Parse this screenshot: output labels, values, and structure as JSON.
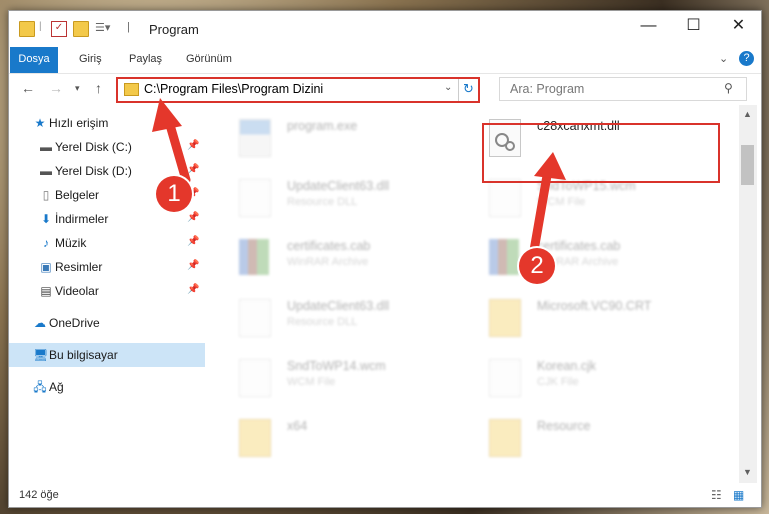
{
  "window": {
    "title": "Program"
  },
  "ribbon": {
    "tabs": [
      "Dosya",
      "Giriş",
      "Paylaş",
      "Görünüm"
    ]
  },
  "address": {
    "path": "C:\\Program Files\\Program Dizini"
  },
  "search": {
    "placeholder": "Ara: Program"
  },
  "sidebar": {
    "items": [
      {
        "label": "Hızlı erişim",
        "icon": "star-icon"
      },
      {
        "label": "Yerel Disk (C:)",
        "icon": "drive-icon"
      },
      {
        "label": "Yerel Disk (D:)",
        "icon": "drive-icon"
      },
      {
        "label": "Belgeler",
        "icon": "document-icon"
      },
      {
        "label": "İndirmeler",
        "icon": "download-icon"
      },
      {
        "label": "Müzik",
        "icon": "music-icon"
      },
      {
        "label": "Resimler",
        "icon": "picture-icon"
      },
      {
        "label": "Videolar",
        "icon": "video-icon"
      },
      {
        "label": "OneDrive",
        "icon": "cloud-icon"
      },
      {
        "label": "Bu bilgisayar",
        "icon": "computer-icon"
      },
      {
        "label": "Ağ",
        "icon": "network-icon"
      }
    ]
  },
  "files": [
    {
      "name": "program.exe",
      "type": ""
    },
    {
      "name": "c28xcanxmt.dll",
      "type": ""
    },
    {
      "name": "UpdateClient63.dll",
      "type": "Resource DLL"
    },
    {
      "name": "SndToWP15.wcm",
      "type": "WCM File"
    },
    {
      "name": "certificates.cab",
      "type": "WinRAR Archive"
    },
    {
      "name": "certificates.cab",
      "type": "WinRAR Archive"
    },
    {
      "name": "UpdateClient63.dll",
      "type": "Resource DLL"
    },
    {
      "name": "Microsoft.VC90.CRT",
      "type": ""
    },
    {
      "name": "SndToWP14.wcm",
      "type": "WCM File"
    },
    {
      "name": "Korean.cjk",
      "type": "CJK File"
    },
    {
      "name": "x64",
      "type": ""
    },
    {
      "name": "Resource",
      "type": ""
    }
  ],
  "status": {
    "count": "142 öğe"
  },
  "annotations": {
    "step1": "1",
    "step2": "2"
  },
  "colors": {
    "accent": "#1979ca",
    "highlight": "#d9332b",
    "selected": "#cce4f7"
  }
}
